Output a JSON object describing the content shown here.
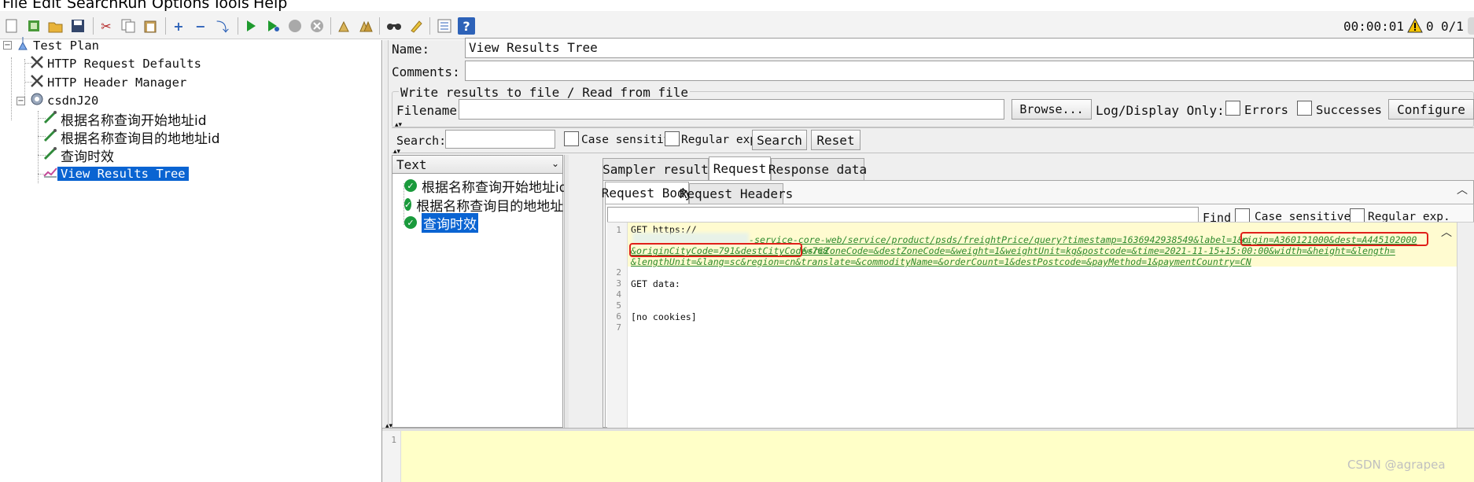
{
  "menu": {
    "items": [
      "File",
      "Edit",
      "Search",
      "Run",
      "Options",
      "Tools",
      "Help"
    ]
  },
  "toolbar": {
    "icons": [
      "new-icon",
      "templates-icon",
      "open-icon",
      "save-icon",
      "cut-icon",
      "copy-icon",
      "paste-icon",
      "expand-icon",
      "collapse-icon",
      "toggle-icon",
      "start-icon",
      "start-no-pauses-icon",
      "stop-icon",
      "shutdown-icon",
      "clear-icon",
      "clear-all-icon",
      "search-icon",
      "reset-search-icon",
      "function-helper-icon",
      "help-icon"
    ],
    "elapsed_time": "00:00:01",
    "warning_count": "0",
    "threads": "0/1"
  },
  "tree": {
    "items": [
      {
        "label": "Test Plan",
        "icon": "test-plan-icon",
        "level": 0
      },
      {
        "label": "HTTP Request Defaults",
        "icon": "config-element-icon",
        "level": 1
      },
      {
        "label": "HTTP Header Manager",
        "icon": "config-element-icon",
        "level": 1
      },
      {
        "label": "csdnJ20",
        "icon": "thread-group-icon",
        "level": 1
      },
      {
        "label": "根据名称查询开始地址id",
        "icon": "sampler-icon",
        "level": 2
      },
      {
        "label": "根据名称查询目的地地址id",
        "icon": "sampler-icon",
        "level": 2
      },
      {
        "label": "查询时效",
        "icon": "sampler-icon",
        "level": 2
      },
      {
        "label": "View Results Tree",
        "icon": "listener-icon",
        "level": 2,
        "selected": true
      }
    ]
  },
  "form": {
    "name_label": "Name:",
    "name_value": "View Results Tree",
    "comments_label": "Comments:",
    "comments_value": "",
    "file_group_title": "Write results to file / Read from file",
    "filename_label": "Filename",
    "filename_value": "",
    "browse_label": "Browse...",
    "log_display_label": "Log/Display Only:",
    "errors_label": "Errors",
    "successes_label": "Successes",
    "configure_label": "Configure"
  },
  "search_bar": {
    "label": "Search:",
    "value": "",
    "case_sensitive_label": "Case sensitive",
    "regex_label": "Regular exp.",
    "search_button": "Search",
    "reset_button": "Reset"
  },
  "renderer": {
    "selected": "Text"
  },
  "results": [
    {
      "label": "根据名称查询开始地址id",
      "status": "success"
    },
    {
      "label": "根据名称查询目的地地址id",
      "status": "success"
    },
    {
      "label": "查询时效",
      "status": "success",
      "selected": true
    }
  ],
  "tabs": [
    "Sampler result",
    "Request",
    "Response data"
  ],
  "active_tab": "Request",
  "subtabs": [
    "Request Body",
    "Request Headers"
  ],
  "active_subtab": "Request Body",
  "find": {
    "label": "Find",
    "value": "",
    "case_sensitive_label": "Case sensitive",
    "regex_label": "Regular exp."
  },
  "code": {
    "line_numbers": [
      "1",
      "",
      "",
      "",
      "2",
      "3",
      "4",
      "5",
      "6",
      "7"
    ],
    "line1_prefix": "GET https://",
    "line1_url_a": "-service-core-web/service/product/psds/freightPrice/query?timestamp=1636942938549&label=1&o",
    "line1_url_hl1": "rigin=A360121000&dest=A445102000",
    "line1_url_hl2": "&originCityCode=791&destCityCode=768",
    "line1_url_b": "&srcZoneCode=&destZoneCode=&weight=1&weightUnit=kg&postcode=&time=2021-11-15+15:00:00&width=&height=&length=",
    "line1_url_c": "&lengthUnit=&lang=sc&region=cn&translate=&commodityName=&orderCount=1&destPostcode=&payMethod=1&paymentCountry=CN",
    "line3": "GET data:",
    "line6": "[no cookies]"
  },
  "bottom_line_number": "1",
  "watermark": "CSDN @agrapea",
  "colors": {
    "selection": "#0a64d2",
    "url_green": "#2e8b2e",
    "highlight_red": "#e0201a",
    "log_yellow": "#ffffc8"
  }
}
